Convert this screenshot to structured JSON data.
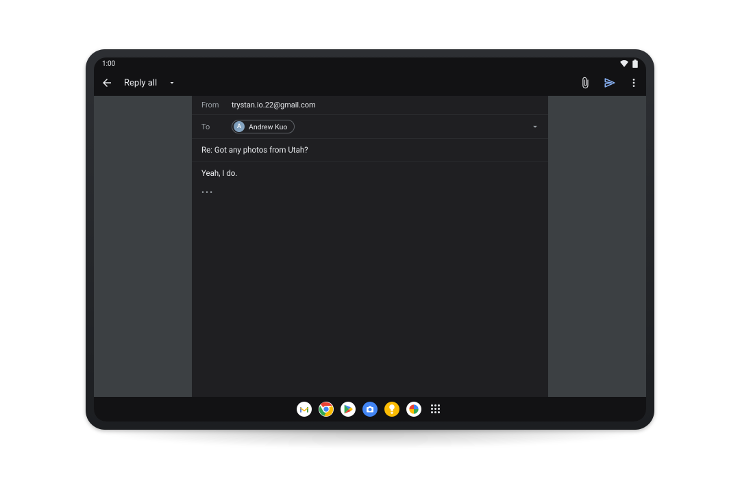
{
  "status": {
    "time": "1:00"
  },
  "appbar": {
    "title": "Reply all"
  },
  "compose": {
    "from_label": "From",
    "from_value": "trystan.io.22@gmail.com",
    "to_label": "To",
    "recipient": {
      "initial": "A",
      "name": "Andrew Kuo"
    },
    "subject": "Re: Got any photos from Utah?",
    "body": "Yeah, I do.",
    "quoted_toggle": "•••"
  },
  "dock": {
    "items": [
      "gmail",
      "chrome",
      "play-store",
      "camera",
      "keep",
      "photos",
      "apps"
    ]
  }
}
